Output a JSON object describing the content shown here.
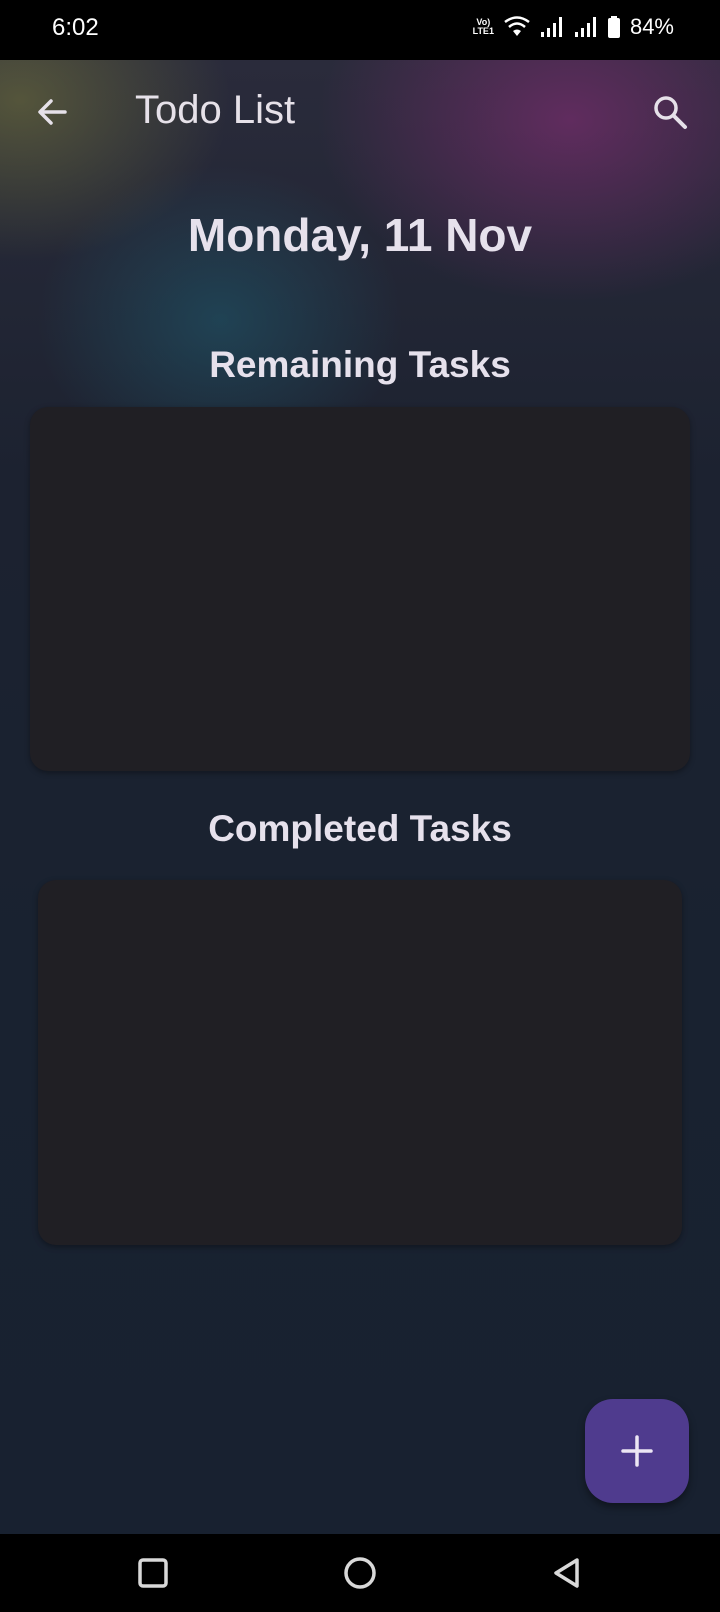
{
  "status_bar": {
    "time": "6:02",
    "volte_line1": "Vo)",
    "volte_line2": "LTE1",
    "battery_percent": "84%",
    "icons": [
      "volte-icon",
      "wifi-icon",
      "signal-icon",
      "signal-icon",
      "battery-icon"
    ]
  },
  "app_bar": {
    "title": "Todo List",
    "back_icon": "arrow-back-icon",
    "search_icon": "search-icon"
  },
  "main": {
    "date": "Monday, 11 Nov",
    "remaining_title": "Remaining Tasks",
    "completed_title": "Completed Tasks"
  },
  "fab": {
    "icon": "plus-icon"
  },
  "nav_bar": {
    "icons": [
      "recents-square-icon",
      "home-circle-icon",
      "back-triangle-icon"
    ]
  },
  "colors": {
    "fab": "#4f3b8e",
    "card": "#201f24",
    "text": "#e6e1ec"
  }
}
